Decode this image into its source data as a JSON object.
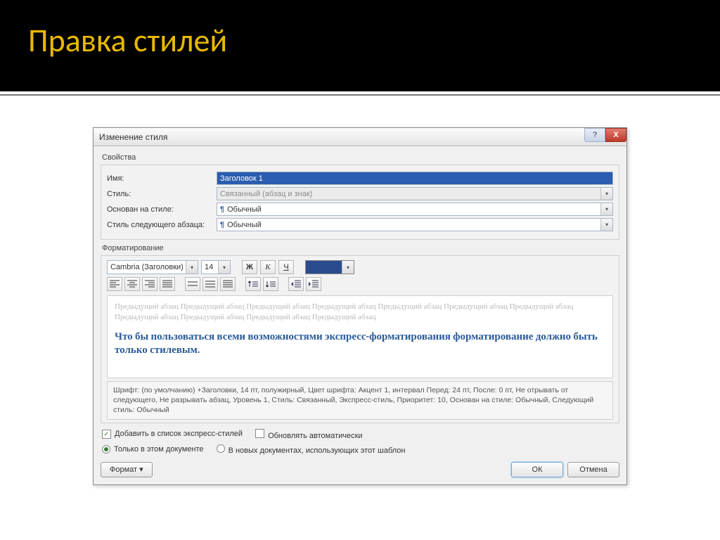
{
  "slide": {
    "title": "Правка стилей"
  },
  "dialog": {
    "title": "Изменение стиля",
    "help": "?",
    "close": "X",
    "section_props": "Свойства",
    "labels": {
      "name": "Имя:",
      "styletype": "Стиль:",
      "basedon": "Основан на стиле:",
      "next": "Стиль следующего абзаца:"
    },
    "values": {
      "name": "Заголовок 1",
      "styletype": "Связанный (абзац и знак)",
      "basedon": "Обычный",
      "next": "Обычный"
    },
    "section_fmt": "Форматирование",
    "font": {
      "family": "Cambria (Заголовки)",
      "size": "14",
      "bold": "Ж",
      "italic": "К",
      "underline": "Ч"
    },
    "preview": {
      "greytext": "Предыдущий абзац Предыдущий абзац Предыдущий абзац Предыдущий абзац Предыдущий абзац Предыдущий абзац Предыдущий абзац Предыдущий абзац Предыдущий абзац Предыдущий абзац Предыдущий абзац",
      "sample": "Что бы пользоваться всеми возможностями экспресс-форматирования форматирование должно быть только стилевым."
    },
    "description": "Шрифт: (по умолчанию) +Заголовки, 14 пт, полужирный, Цвет шрифта: Акцент 1, интервал Перед: 24 пт, После: 0 пт, Не отрывать от следующего, Не разрывать абзац, Уровень 1, Стиль: Связанный, Экспресс-стиль, Приоритет: 10, Основан на стиле: Обычный, Следующий стиль: Обычный",
    "opt_add_express": "Добавить в список экспресс-стилей",
    "opt_auto_update": "Обновлять автоматически",
    "opt_this_doc": "Только в этом документе",
    "opt_new_docs": "В новых документах, использующих этот шаблон",
    "btn_format": "Формат",
    "btn_ok": "ОК",
    "btn_cancel": "Отмена"
  }
}
